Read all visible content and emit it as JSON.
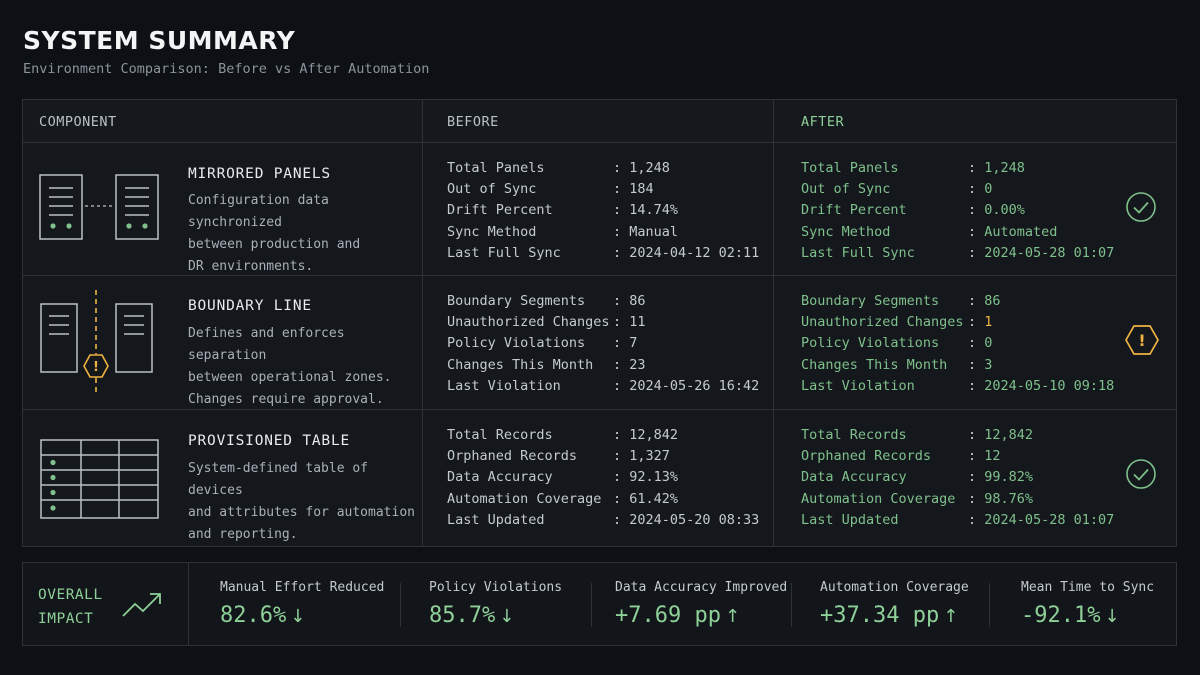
{
  "header": {
    "title": "SYSTEM SUMMARY",
    "subtitle": "Environment Comparison: Before vs After Automation"
  },
  "table": {
    "columns": {
      "component": "COMPONENT",
      "before": "BEFORE",
      "after": "AFTER"
    },
    "rows": [
      {
        "icon": "mirrored-panels-icon",
        "title": "MIRRORED PANELS",
        "description": [
          "Configuration data synchronized",
          "between production and",
          "DR environments."
        ],
        "before": [
          {
            "key": "Total Panels",
            "value": "1,248"
          },
          {
            "key": "Out of Sync",
            "value": "184"
          },
          {
            "key": "Drift Percent",
            "value": "14.74%"
          },
          {
            "key": "Sync Method",
            "value": "Manual"
          },
          {
            "key": "Last Full Sync",
            "value": "2024-04-12 02:11"
          }
        ],
        "after": [
          {
            "key": "Total Panels",
            "value": "1,248"
          },
          {
            "key": "Out of Sync",
            "value": "0"
          },
          {
            "key": "Drift Percent",
            "value": "0.00%"
          },
          {
            "key": "Sync Method",
            "value": "Automated"
          },
          {
            "key": "Last Full Sync",
            "value": "2024-05-28 01:07"
          }
        ],
        "status_icon": "check-circle-icon"
      },
      {
        "icon": "boundary-line-icon",
        "title": "BOUNDARY LINE",
        "description": [
          "Defines and enforces separation",
          "between operational zones.",
          "Changes require approval."
        ],
        "before": [
          {
            "key": "Boundary Segments",
            "value": "86"
          },
          {
            "key": "Unauthorized Changes",
            "value": "11"
          },
          {
            "key": "Policy Violations",
            "value": "7"
          },
          {
            "key": "Changes This Month",
            "value": "23"
          },
          {
            "key": "Last Violation",
            "value": "2024-05-26 16:42"
          }
        ],
        "after": [
          {
            "key": "Boundary Segments",
            "value": "86"
          },
          {
            "key": "Unauthorized Changes",
            "value": "1"
          },
          {
            "key": "Policy Violations",
            "value": "0"
          },
          {
            "key": "Changes This Month",
            "value": "3"
          },
          {
            "key": "Last Violation",
            "value": "2024-05-10 09:18"
          }
        ],
        "status_icon": "warning-hexagon-icon"
      },
      {
        "icon": "provisioned-table-icon",
        "title": "PROVISIONED TABLE",
        "description": [
          "System-defined table of devices",
          "and attributes for automation",
          "and reporting."
        ],
        "before": [
          {
            "key": "Total Records",
            "value": "12,842"
          },
          {
            "key": "Orphaned Records",
            "value": "1,327"
          },
          {
            "key": "Data Accuracy",
            "value": "92.13%"
          },
          {
            "key": "Automation Coverage",
            "value": "61.42%"
          },
          {
            "key": "Last Updated",
            "value": "2024-05-20 08:33"
          }
        ],
        "after": [
          {
            "key": "Total Records",
            "value": "12,842"
          },
          {
            "key": "Orphaned Records",
            "value": "12"
          },
          {
            "key": "Data Accuracy",
            "value": "99.82%"
          },
          {
            "key": "Automation Coverage",
            "value": "98.76%"
          },
          {
            "key": "Last Updated",
            "value": "2024-05-28 01:07"
          }
        ],
        "status_icon": "check-circle-icon"
      }
    ]
  },
  "impact": {
    "label": [
      "OVERALL",
      "IMPACT"
    ],
    "icon": "trend-up-icon",
    "metrics": [
      {
        "label": "Manual Effort Reduced",
        "value": "82.6%",
        "arrow": "↓"
      },
      {
        "label": "Policy Violations",
        "value": "85.7%",
        "arrow": "↓"
      },
      {
        "label": "Data Accuracy Improved",
        "value": "+7.69 pp",
        "arrow": "↑"
      },
      {
        "label": "Automation Coverage",
        "value": "+37.34 pp",
        "arrow": "↑"
      },
      {
        "label": "Mean Time to Sync",
        "value": "-92.1%",
        "arrow": "↓"
      }
    ]
  },
  "colors": {
    "background": "#0d1014",
    "accent_green": "#8fcf98",
    "warning": "#f0b341",
    "border": "#2c3238"
  }
}
